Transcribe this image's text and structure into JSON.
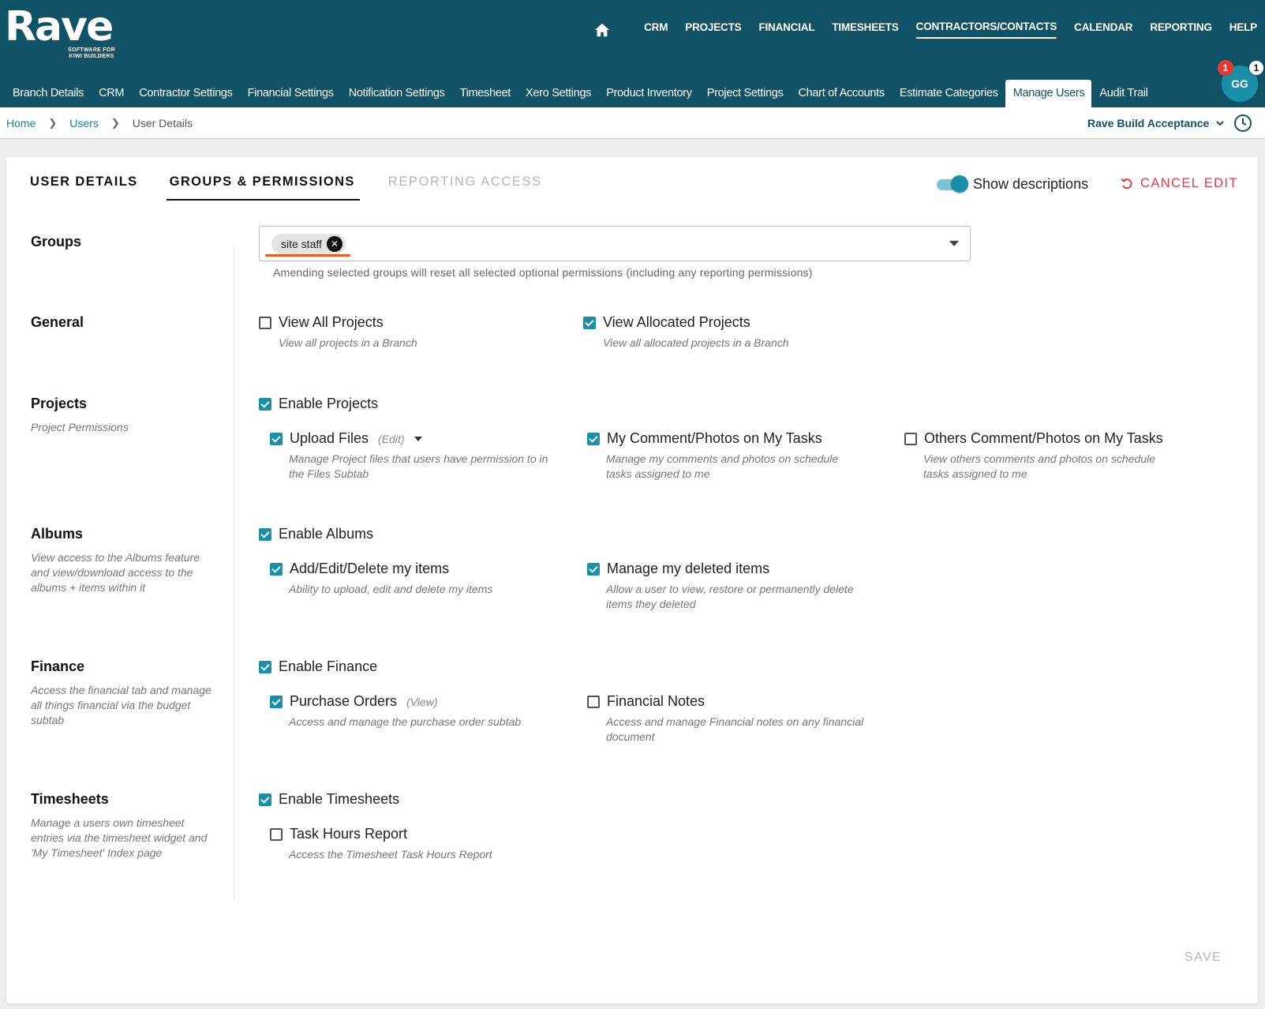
{
  "brand": {
    "logo": "Rave",
    "tagline_line1": "SOFTWARE FOR",
    "tagline_line2": "KIWI BUILDERS"
  },
  "topnav": [
    "CRM",
    "PROJECTS",
    "FINANCIAL",
    "TIMESHEETS",
    "CONTRACTORS/CONTACTS",
    "CALENDAR",
    "REPORTING",
    "HELP"
  ],
  "topnav_active": "CONTRACTORS/CONTACTS",
  "subnav": [
    "Branch Details",
    "CRM",
    "Contractor Settings",
    "Financial Settings",
    "Notification Settings",
    "Timesheet",
    "Xero Settings",
    "Product Inventory",
    "Project Settings",
    "Chart of Accounts",
    "Estimate Categories",
    "Manage Users",
    "Audit Trail"
  ],
  "subnav_active": "Manage Users",
  "user": {
    "initials": "GG",
    "badge_red": "1",
    "badge_white": "1"
  },
  "breadcrumb": {
    "home": "Home",
    "users": "Users",
    "current": "User Details"
  },
  "branch_selector": "Rave Build Acceptance",
  "tabs": {
    "user_details": "USER DETAILS",
    "groups_permissions": "GROUPS & PERMISSIONS",
    "reporting_access": "REPORTING ACCESS"
  },
  "show_descriptions": {
    "label": "Show descriptions",
    "on": true
  },
  "cancel_edit": "CANCEL EDIT",
  "groups": {
    "title": "Groups",
    "selected_chip": "site staff",
    "help": "Amending selected groups will reset all selected optional permissions (including any reporting permissions)"
  },
  "sections": {
    "general": {
      "title": "General",
      "view_all": {
        "label": "View All Projects",
        "desc": "View all projects in a Branch",
        "checked": false
      },
      "view_allocated": {
        "label": "View Allocated Projects",
        "desc": "View all allocated projects in a Branch",
        "checked": true
      }
    },
    "projects": {
      "title": "Projects",
      "desc": "Project Permissions",
      "enable": {
        "label": "Enable Projects",
        "checked": true
      },
      "upload_files": {
        "label": "Upload Files",
        "mode": "(Edit)",
        "desc": "Manage Project files that users have permission to in the Files Subtab",
        "checked": true
      },
      "my_comment": {
        "label": "My Comment/Photos on My Tasks",
        "desc": "Manage my comments and photos on schedule tasks assigned to me",
        "checked": true
      },
      "others_comment": {
        "label": "Others Comment/Photos on My Tasks",
        "desc": "View others comments and photos on schedule tasks assigned to me",
        "checked": false
      }
    },
    "albums": {
      "title": "Albums",
      "desc": "View access to the Albums feature and view/download access to the albums + items within it",
      "enable": {
        "label": "Enable Albums",
        "checked": true
      },
      "add_edit": {
        "label": "Add/Edit/Delete my items",
        "desc": "Ability to upload, edit and delete my items",
        "checked": true
      },
      "manage_deleted": {
        "label": "Manage my deleted items",
        "desc": "Allow a user to view, restore or permanently delete items they deleted",
        "checked": true
      }
    },
    "finance": {
      "title": "Finance",
      "desc": "Access the financial tab and manage all things financial via the budget subtab",
      "enable": {
        "label": "Enable Finance",
        "checked": true
      },
      "purchase_orders": {
        "label": "Purchase Orders",
        "mode": "(View)",
        "desc": "Access and manage the purchase order subtab",
        "checked": true
      },
      "financial_notes": {
        "label": "Financial Notes",
        "desc": "Access and manage Financial notes on any financial document",
        "checked": false
      }
    },
    "timesheets": {
      "title": "Timesheets",
      "desc": "Manage a users own timesheet entries via the timesheet widget and 'My Timesheet' Index page",
      "enable": {
        "label": "Enable Timesheets",
        "checked": true
      },
      "task_hours": {
        "label": "Task Hours Report",
        "desc": "Access the Timesheet Task Hours Report",
        "checked": false
      }
    }
  },
  "save": "SAVE",
  "colors": {
    "header": "#115366",
    "accent": "#1a8fa8",
    "danger": "#e53950",
    "highlight": "#f25c19"
  }
}
